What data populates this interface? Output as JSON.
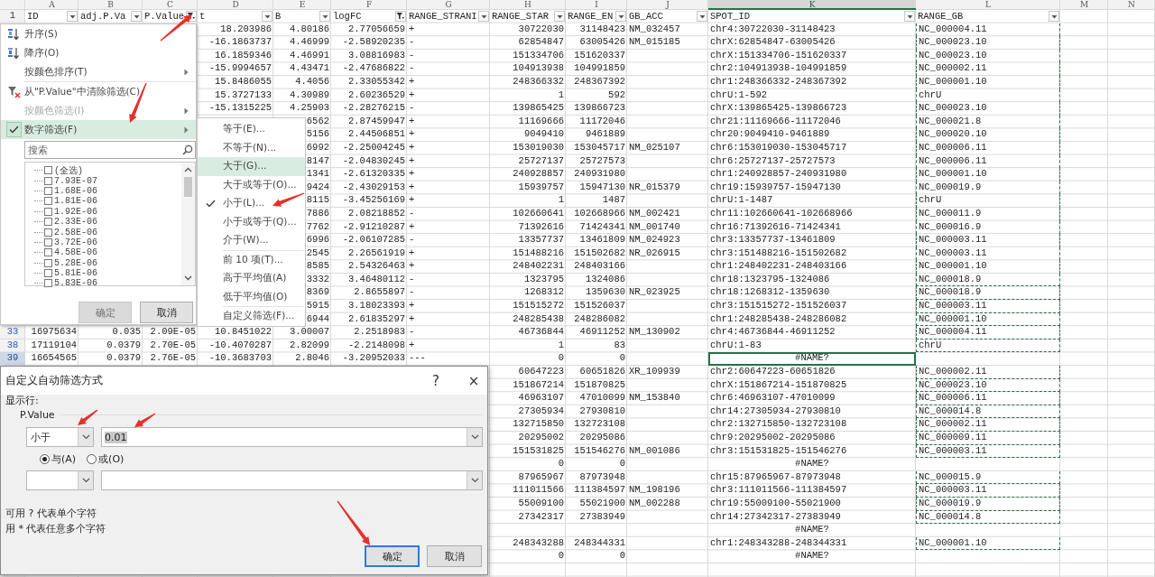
{
  "sheet": {
    "columns": [
      {
        "letter": "A",
        "selected": false
      },
      {
        "letter": "B",
        "selected": false
      },
      {
        "letter": "C",
        "selected": false
      },
      {
        "letter": "D",
        "selected": false
      },
      {
        "letter": "E",
        "selected": false
      },
      {
        "letter": "F",
        "selected": false
      },
      {
        "letter": "G",
        "selected": false
      },
      {
        "letter": "H",
        "selected": false
      },
      {
        "letter": "I",
        "selected": false
      },
      {
        "letter": "J",
        "selected": false
      },
      {
        "letter": "K",
        "selected": true
      },
      {
        "letter": "L",
        "selected": false
      },
      {
        "letter": "M",
        "selected": false
      },
      {
        "letter": "N",
        "selected": false
      }
    ],
    "header_row": {
      "row_number": "1",
      "cells": [
        {
          "text": "ID",
          "filtered": false
        },
        {
          "text": "adj.P.Va",
          "filtered": false
        },
        {
          "text": "P.Value",
          "filtered": true
        },
        {
          "text": "t",
          "filtered": false
        },
        {
          "text": "B",
          "filtered": false
        },
        {
          "text": "logFC",
          "filtered": true
        },
        {
          "text": "RANGE_STRANI",
          "filtered": false
        },
        {
          "text": "RANGE_STAR",
          "filtered": false
        },
        {
          "text": "RANGE_EN",
          "filtered": false
        },
        {
          "text": "GB_ACC",
          "filtered": false
        },
        {
          "text": "SPOT_ID",
          "filtered": false
        },
        {
          "text": "RANGE_GB",
          "filtered": false
        }
      ]
    },
    "rows": [
      {
        "selected": false,
        "cells": {
          "D": "18.203986",
          "E": "4.80186",
          "F": "2.77056659",
          "G": "+",
          "H": "30722030",
          "I": "31148423",
          "J": "NM_032457",
          "K": "chr4:30722030-31148423",
          "L": "NC_000004.11"
        }
      },
      {
        "selected": false,
        "cells": {
          "D": "-16.1863737",
          "E": "4.46999",
          "F": "-2.58920235",
          "G": "-",
          "H": "62854847",
          "I": "63005426",
          "J": "NM_015185",
          "K": "chrX:62854847-63005426",
          "L": "NC_000023.10"
        }
      },
      {
        "selected": false,
        "cells": {
          "D": "16.1859346",
          "E": "4.46991",
          "F": "3.08816983",
          "G": "-",
          "H": "151334706",
          "I": "151620337",
          "K": "chrX:151334706-151620337",
          "L": "NC_000023.10"
        }
      },
      {
        "selected": false,
        "cells": {
          "D": "-15.9994657",
          "E": "4.43471",
          "F": "-2.47686822",
          "G": "-",
          "H": "104913938",
          "I": "104991859",
          "K": "chr2:104913938-104991859",
          "L": "NC_000002.11"
        }
      },
      {
        "selected": false,
        "cells": {
          "D": "15.8486055",
          "E": "4.4056",
          "F": "2.33055342",
          "G": "+",
          "H": "248366332",
          "I": "248367392",
          "K": "chr1:248366332-248367392",
          "L": "NC_000001.10"
        }
      },
      {
        "selected": false,
        "cells": {
          "D": "15.3727133",
          "E": "4.30989",
          "F": "2.60236529",
          "G": "+",
          "H": "1",
          "I": "592",
          "K": "chrU:1-592",
          "L": "chrU"
        }
      },
      {
        "selected": false,
        "cells": {
          "D": "-15.1315225",
          "E": "4.25903",
          "F": "-2.28276215",
          "G": "-",
          "H": "139865425",
          "I": "139866723",
          "K": "chrX:139865425-139866723",
          "L": "NC_000023.10"
        }
      },
      {
        "selected": false,
        "cells": {
          "E": "6562",
          "F": "2.87459947",
          "G": "+",
          "H": "11169666",
          "I": "11172046",
          "K": "chr21:11169666-11172046",
          "L": "NC_000021.8"
        }
      },
      {
        "selected": false,
        "cells": {
          "E": "5156",
          "F": "2.44506851",
          "G": "+",
          "H": "9049410",
          "I": "9461889",
          "K": "chr20:9049410-9461889",
          "L": "NC_000020.10"
        }
      },
      {
        "selected": false,
        "cells": {
          "E": "6992",
          "F": "-2.25004245",
          "G": "+",
          "H": "153019030",
          "I": "153045717",
          "J": "NM_025107",
          "K": "chr6:153019030-153045717",
          "L": "NC_000006.11"
        }
      },
      {
        "selected": false,
        "cells": {
          "E": "8147",
          "F": "-2.04830245",
          "G": "+",
          "H": "25727137",
          "I": "25727573",
          "K": "chr6:25727137-25727573",
          "L": "NC_000006.11"
        }
      },
      {
        "selected": false,
        "cells": {
          "E": "1341",
          "F": "-2.61320335",
          "G": "+",
          "H": "240928857",
          "I": "240931980",
          "K": "chr1:240928857-240931980",
          "L": "NC_000001.10"
        }
      },
      {
        "selected": false,
        "cells": {
          "E": "9424",
          "F": "-2.43029153",
          "G": "+",
          "H": "15939757",
          "I": "15947130",
          "J": "NR_015379",
          "K": "chr19:15939757-15947130",
          "L": "NC_000019.9"
        }
      },
      {
        "selected": false,
        "cells": {
          "E": "8115",
          "F": "-3.45256169",
          "G": "+",
          "H": "1",
          "I": "1487",
          "K": "chrU:1-1487",
          "L": "chrU"
        }
      },
      {
        "selected": false,
        "cells": {
          "E": "7886",
          "F": "2.08218852",
          "G": "-",
          "H": "102660641",
          "I": "102668966",
          "J": "NM_002421",
          "K": "chr11:102660641-102668966",
          "L": "NC_000011.9"
        }
      },
      {
        "selected": false,
        "cells": {
          "E": "7762",
          "F": "-2.91210287",
          "G": "+",
          "H": "71392616",
          "I": "71424341",
          "J": "NM_001740",
          "K": "chr16:71392616-71424341",
          "L": "NC_000016.9"
        }
      },
      {
        "selected": false,
        "cells": {
          "E": "6996",
          "F": "-2.06107285",
          "G": "-",
          "H": "13357737",
          "I": "13461809",
          "J": "NM_024923",
          "K": "chr3:13357737-13461809",
          "L": "NC_000003.11"
        }
      },
      {
        "selected": false,
        "cells": {
          "E": "2545",
          "F": "2.26561919",
          "G": "+",
          "H": "151488216",
          "I": "151502682",
          "J": "NR_026915",
          "K": "chr3:151488216-151502682",
          "L": "NC_000003.11"
        }
      },
      {
        "selected": false,
        "cells": {
          "E": "8585",
          "F": "2.54326463",
          "G": "+",
          "H": "248402231",
          "I": "248403166",
          "K": "chr1:248402231-248403166",
          "L": "NC_000001.10"
        }
      },
      {
        "selected": false,
        "cells": {
          "E": "3332",
          "F": "3.46480112",
          "G": "-",
          "H": "1323795",
          "I": "1324086",
          "K": "chr18:1323795-1324086",
          "L": "NC_000018.9"
        }
      },
      {
        "selected": false,
        "cells": {
          "E": "8369",
          "F": "2.8655897",
          "G": "-",
          "H": "1268312",
          "I": "1359630",
          "J": "NR_023925",
          "K": "chr18:1268312-1359630",
          "L": "NC_000018.9"
        }
      },
      {
        "selected": false,
        "cells": {
          "E": "5915",
          "F": "3.18023393",
          "G": "+",
          "H": "151515272",
          "I": "151526037",
          "K": "chr3:151515272-151526037",
          "L": "NC_000003.11"
        }
      },
      {
        "selected": false,
        "cells": {
          "E": "6944",
          "F": "2.61835297",
          "G": "+",
          "H": "248285438",
          "I": "248286082",
          "K": "chr1:248285438-248286082",
          "L": "NC_000001.10"
        }
      },
      {
        "row_number": "33",
        "selected": false,
        "cells": {
          "A": "16975634",
          "B": "0.035",
          "C": "2.09E-05",
          "D": "10.8451022",
          "E": "3.00007",
          "F": "2.2518983",
          "G": "-",
          "H": "46736844",
          "I": "46911252",
          "J": "NM_130902",
          "K": "chr4:46736844-46911252",
          "L": "NC_000004.11"
        }
      },
      {
        "row_number": "38",
        "selected": false,
        "cells": {
          "A": "17119104",
          "B": "0.0379",
          "C": "2.70E-05",
          "D": "-10.4070287",
          "E": "2.82099",
          "F": "-2.2148098",
          "G": "+",
          "H": "1",
          "I": "83",
          "K": "chrU:1-83",
          "L": "chrU"
        }
      },
      {
        "row_number": "39",
        "selected": true,
        "cells": {
          "A": "16654565",
          "B": "0.0379",
          "C": "2.76E-05",
          "D": "-10.3683703",
          "E": "2.8046",
          "F": "-3.20952033",
          "G": "---",
          "H": "0",
          "I": "0",
          "K": "#NAME?"
        }
      },
      {
        "selected": false,
        "cells": {
          "H": "60647223",
          "I": "60651826",
          "J": "XR_109939",
          "K": "chr2:60647223-60651826",
          "L": "NC_000002.11"
        }
      },
      {
        "selected": false,
        "cells": {
          "H": "151867214",
          "I": "151870825",
          "K": "chrX:151867214-151870825",
          "L": "NC_000023.10"
        }
      },
      {
        "selected": false,
        "cells": {
          "H": "46963107",
          "I": "47010099",
          "J": "NM_153840",
          "K": "chr6:46963107-47010099",
          "L": "NC_000006.11"
        }
      },
      {
        "selected": false,
        "cells": {
          "H": "27305934",
          "I": "27930810",
          "K": "chr14:27305934-27930810",
          "L": "NC_000014.8"
        }
      },
      {
        "selected": false,
        "cells": {
          "H": "132715850",
          "I": "132723108",
          "K": "chr2:132715850-132723108",
          "L": "NC_000002.11"
        }
      },
      {
        "selected": false,
        "cells": {
          "H": "20295002",
          "I": "20295086",
          "K": "chr9:20295002-20295086",
          "L": "NC_000009.11"
        }
      },
      {
        "selected": false,
        "cells": {
          "H": "151531825",
          "I": "151546276",
          "J": "NM_001086",
          "K": "chr3:151531825-151546276",
          "L": "NC_000003.11"
        }
      },
      {
        "selected": false,
        "cells": {
          "H": "0",
          "I": "0",
          "K": "#NAME?"
        }
      },
      {
        "selected": false,
        "cells": {
          "H": "87965967",
          "I": "87973948",
          "K": "chr15:87965967-87973948",
          "L": "NC_000015.9"
        }
      },
      {
        "selected": false,
        "cells": {
          "H": "111011566",
          "I": "111384597",
          "J": "NM_198196",
          "K": "chr3:111011566-111384597",
          "L": "NC_000003.11"
        }
      },
      {
        "selected": false,
        "cells": {
          "H": "55009100",
          "I": "55021900",
          "J": "NM_002288",
          "K": "chr19:55009100-55021900",
          "L": "NC_000019.9"
        }
      },
      {
        "selected": false,
        "cells": {
          "H": "27342317",
          "I": "27383949",
          "K": "chr14:27342317-27383949",
          "L": "NC_000014.8"
        }
      },
      {
        "selected": false,
        "cells": {
          "K": "#NAME?"
        }
      },
      {
        "selected": false,
        "cells": {
          "H": "248343288",
          "I": "248344331",
          "K": "chr1:248343288-248344331",
          "L": "NC_000001.10"
        }
      },
      {
        "selected": false,
        "cells": {
          "H": "0",
          "I": "0",
          "K": "#NAME?"
        }
      }
    ]
  },
  "filter_menu": {
    "items": [
      {
        "kind": "sort_ascending",
        "label": "升序(S)",
        "disabled": false,
        "has_submenu": false,
        "checked": false,
        "highlighted": false
      },
      {
        "kind": "sort_descending",
        "label": "降序(O)",
        "disabled": false,
        "has_submenu": false,
        "checked": false,
        "highlighted": false
      },
      {
        "kind": "command",
        "label": "按颜色排序(T)",
        "disabled": false,
        "has_submenu": true,
        "checked": false,
        "highlighted": false
      },
      {
        "kind": "separator"
      },
      {
        "kind": "clear_filter",
        "label": "从\"P.Value\"中清除筛选(C)",
        "disabled": false,
        "has_submenu": false,
        "checked": false,
        "highlighted": false
      },
      {
        "kind": "command",
        "label": "按颜色筛选(I)",
        "disabled": true,
        "has_submenu": true,
        "checked": false,
        "highlighted": false
      },
      {
        "kind": "command",
        "label": "数字筛选(F)",
        "disabled": false,
        "has_submenu": true,
        "checked": true,
        "highlighted": true
      }
    ],
    "search": {
      "placeholder": "搜索"
    },
    "values": [
      {
        "label": "(全选)",
        "checked": false
      },
      {
        "label": "7.93E-07",
        "checked": false
      },
      {
        "label": "1.68E-06",
        "checked": false
      },
      {
        "label": "1.81E-06",
        "checked": false
      },
      {
        "label": "1.92E-06",
        "checked": false
      },
      {
        "label": "2.33E-06",
        "checked": false
      },
      {
        "label": "2.58E-06",
        "checked": false
      },
      {
        "label": "3.72E-06",
        "checked": false
      },
      {
        "label": "4.58E-06",
        "checked": false
      },
      {
        "label": "5.28E-06",
        "checked": false
      },
      {
        "label": "5.81E-06",
        "checked": false
      },
      {
        "label": "5.83E-06",
        "checked": false
      }
    ],
    "buttons": [
      {
        "label": "确定",
        "disabled": true
      },
      {
        "label": "取消",
        "disabled": false
      }
    ]
  },
  "number_filter_menu": {
    "items": [
      {
        "kind": "item",
        "label": "等于(E)...",
        "checked": false,
        "highlighted": false
      },
      {
        "kind": "item",
        "label": "不等于(N)...",
        "checked": false,
        "highlighted": false
      },
      {
        "kind": "item",
        "label": "大于(G)...",
        "checked": false,
        "highlighted": true
      },
      {
        "kind": "item",
        "label": "大于或等于(O)...",
        "checked": false,
        "highlighted": false
      },
      {
        "kind": "item",
        "label": "小于(L)...",
        "checked": true,
        "highlighted": false
      },
      {
        "kind": "item",
        "label": "小于或等于(Q)...",
        "checked": false,
        "highlighted": false
      },
      {
        "kind": "item",
        "label": "介于(W)...",
        "checked": false,
        "highlighted": false
      },
      {
        "kind": "separator"
      },
      {
        "kind": "item",
        "label": "前 10 项(T)...",
        "checked": false,
        "highlighted": false
      },
      {
        "kind": "item",
        "label": "高于平均值(A)",
        "checked": false,
        "highlighted": false
      },
      {
        "kind": "item",
        "label": "低于平均值(O)",
        "checked": false,
        "highlighted": false
      },
      {
        "kind": "separator"
      },
      {
        "kind": "item",
        "label": "自定义筛选(F)...",
        "checked": false,
        "highlighted": false
      }
    ]
  },
  "dialog": {
    "title": "自定义自动筛选方式",
    "help": "?",
    "close": "×",
    "show_rows_label": "显示行:",
    "field_label": "P.Value",
    "condition": {
      "operator": "小于",
      "value": "0.01",
      "value_selected": true
    },
    "join": [
      {
        "label": "与(A)",
        "selected": true
      },
      {
        "label": "或(O)",
        "selected": false
      }
    ],
    "hints": [
      "可用 ? 代表单个字符",
      "用 * 代表任意多个字符"
    ],
    "buttons": [
      {
        "label": "确定",
        "default": true
      },
      {
        "label": "取消",
        "default": false
      }
    ]
  }
}
